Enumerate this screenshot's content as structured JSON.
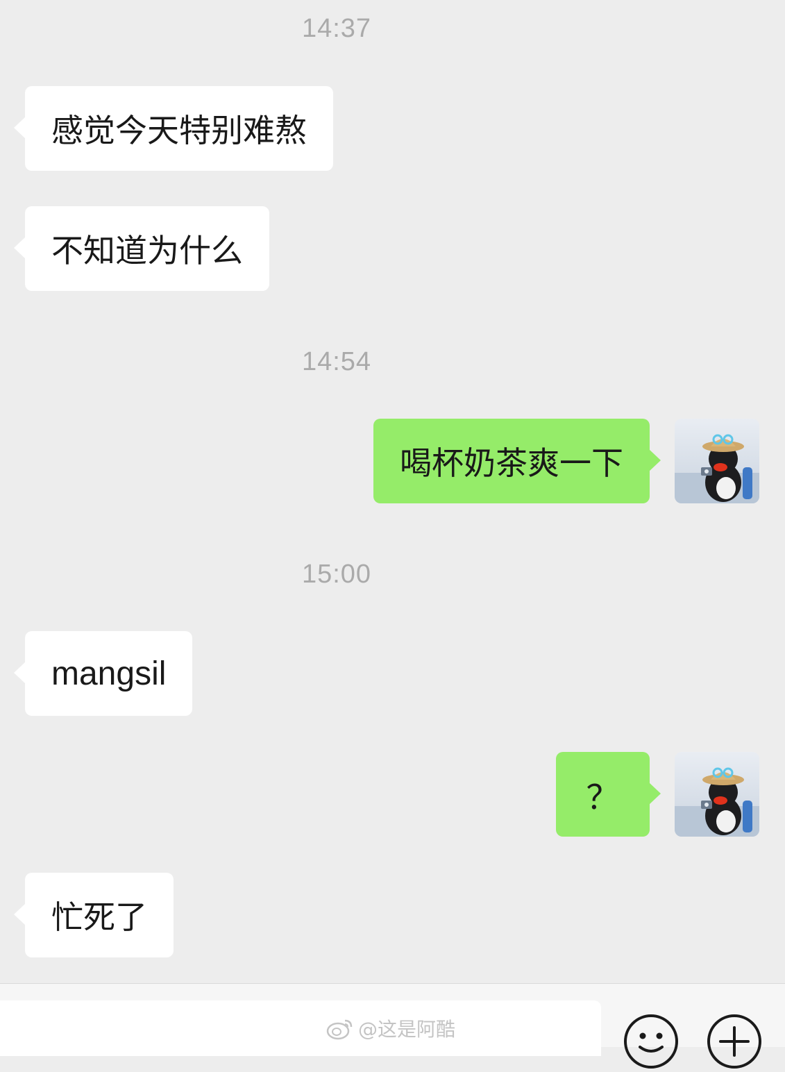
{
  "chat": {
    "timestamps": [
      "14:37",
      "14:54",
      "15:00"
    ],
    "messages": [
      {
        "side": "left",
        "text": "感觉今天特别难熬"
      },
      {
        "side": "left",
        "text": "不知道为什么"
      },
      {
        "side": "right",
        "text": "喝杯奶茶爽一下"
      },
      {
        "side": "left",
        "text": "mangsil"
      },
      {
        "side": "right",
        "text": "？"
      },
      {
        "side": "left",
        "text": "忙死了"
      }
    ]
  },
  "input_bar": {
    "watermark": "@这是阿酷",
    "emoji_icon": "emoji-face-icon",
    "plus_icon": "plus-circle-icon"
  },
  "colors": {
    "background": "#ededed",
    "incoming_bubble": "#ffffff",
    "outgoing_bubble": "#95ec69",
    "timestamp_text": "#aaaaaa"
  }
}
